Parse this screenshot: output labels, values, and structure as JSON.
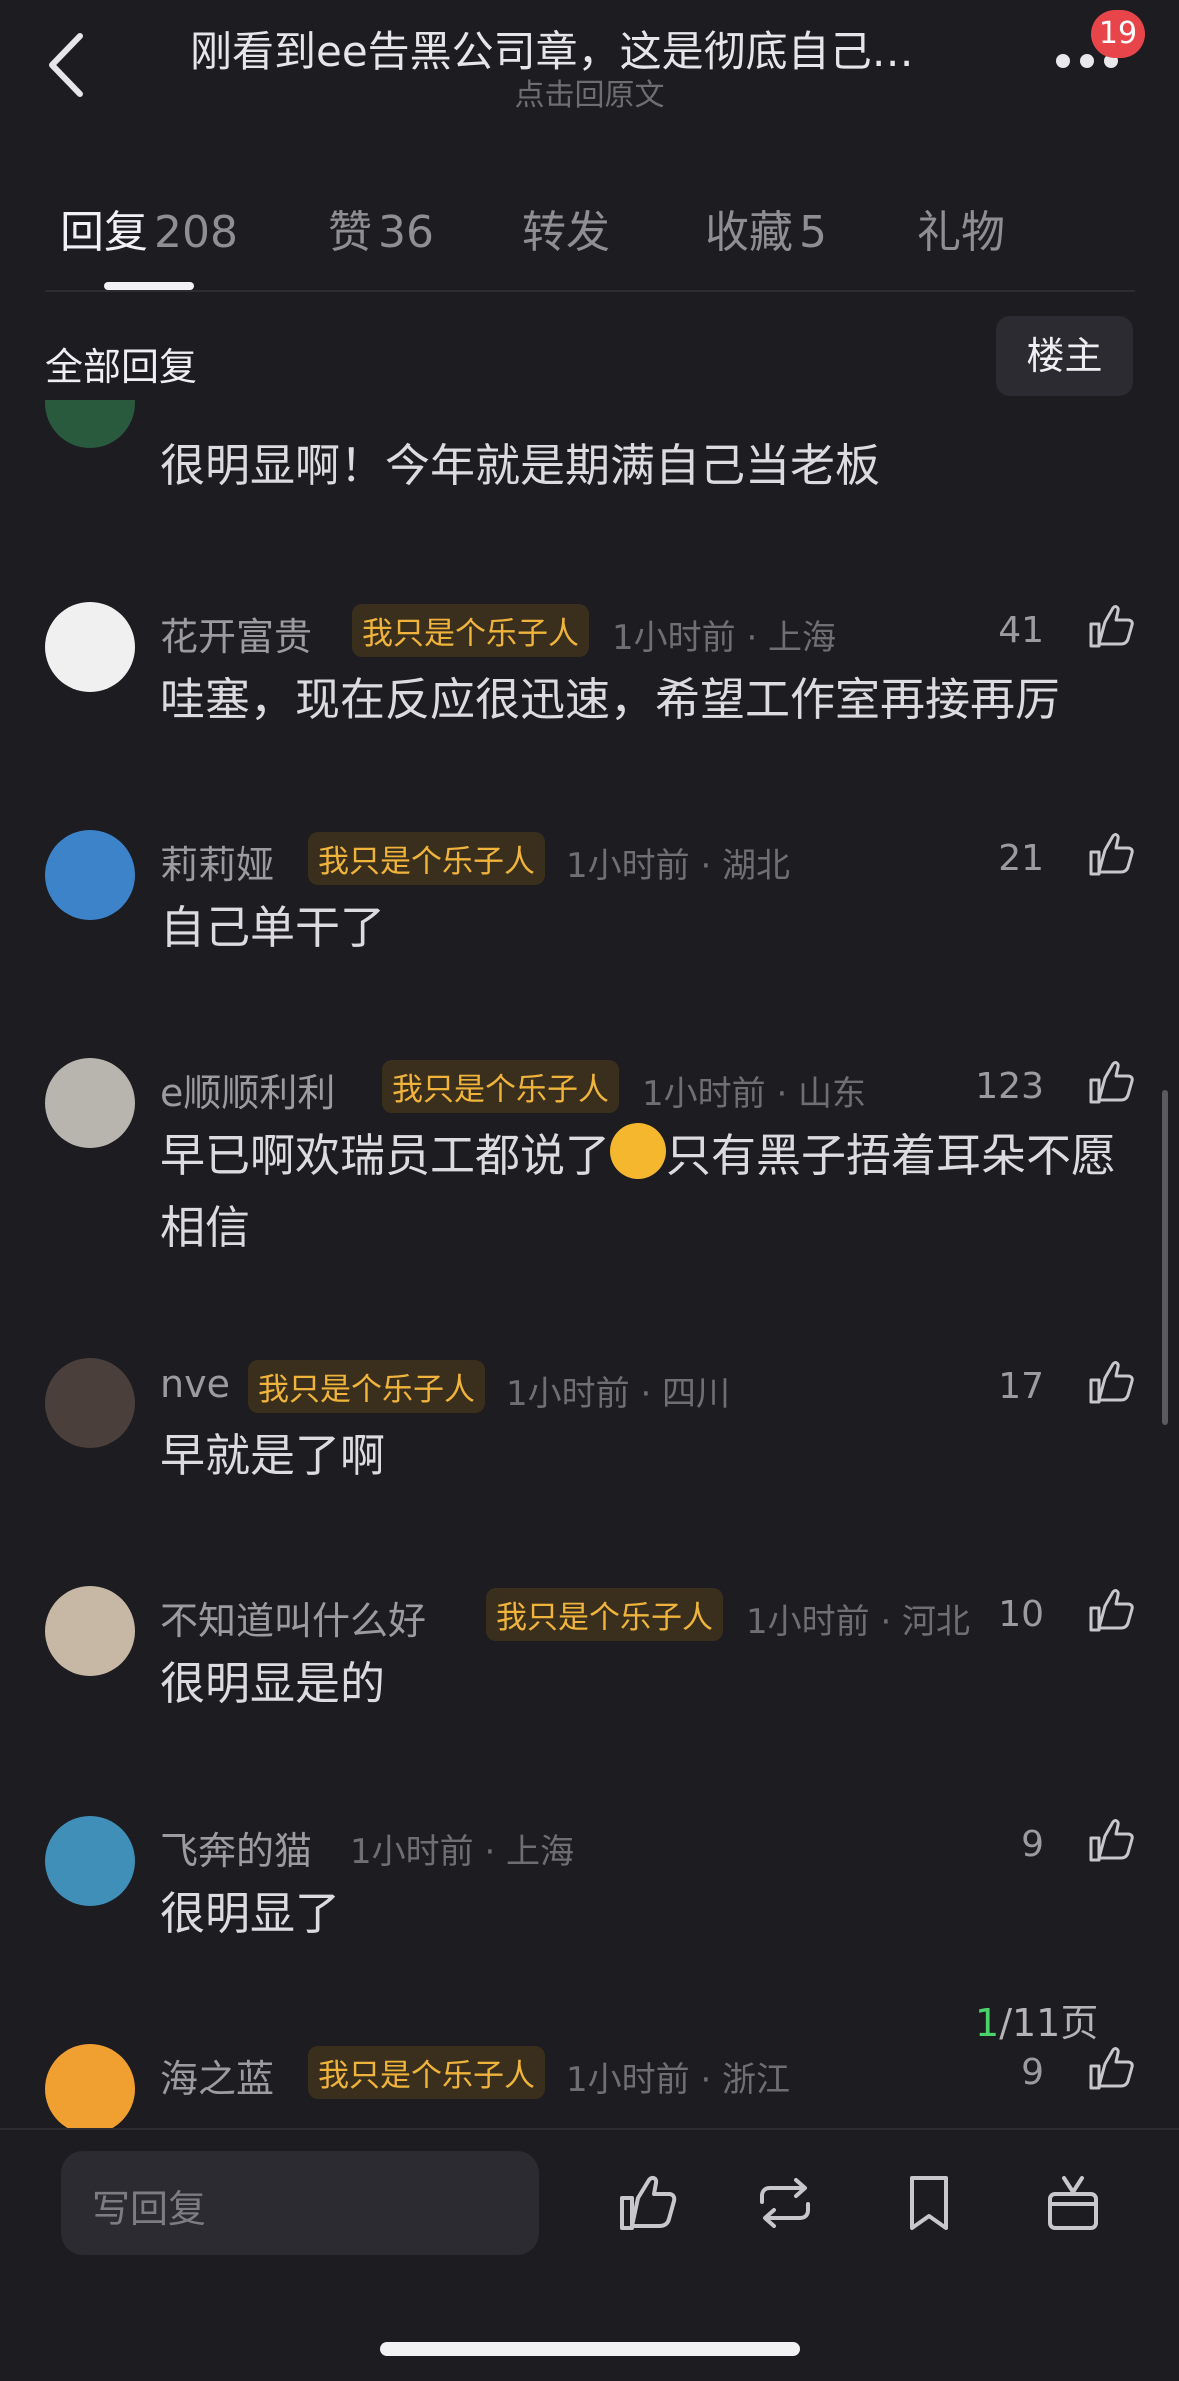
{
  "header": {
    "title": "刚看到ee告黑公司章，这是彻底自己…",
    "subtitle": "点击回原文",
    "notification_count": "19"
  },
  "tabs": [
    {
      "label": "回复",
      "count": "208"
    },
    {
      "label": "赞",
      "count": "36"
    },
    {
      "label": "转发",
      "count": ""
    },
    {
      "label": "收藏",
      "count": "5"
    },
    {
      "label": "礼物",
      "count": ""
    }
  ],
  "filter": {
    "all_label": "全部回复",
    "owner_label": "楼主"
  },
  "comments": [
    {
      "name": "",
      "tag": "",
      "meta": "",
      "likes": "",
      "content": "很明显啊！今年就是期满自己当老板"
    },
    {
      "name": "花开富贵",
      "tag": "我只是个乐子人",
      "meta": "1小时前 · 上海",
      "likes": "41",
      "content": "哇塞，现在反应很迅速，希望工作室再接再厉"
    },
    {
      "name": "莉莉娅",
      "tag": "我只是个乐子人",
      "meta": "1小时前 · 湖北",
      "likes": "21",
      "content": "自己单干了"
    },
    {
      "name": "e顺顺利利",
      "tag": "我只是个乐子人",
      "meta": "1小时前 · 山东",
      "likes": "123",
      "content_a": "早已啊欢瑞员工都说了",
      "content_b": "只有黑子捂着耳朵不愿相信"
    },
    {
      "name": "nve",
      "tag": "我只是个乐子人",
      "meta": "1小时前 · 四川",
      "likes": "17",
      "content": "早就是了啊"
    },
    {
      "name": "不知道叫什么好",
      "tag": "我只是个乐子人",
      "meta": "1小时前 · 河北",
      "likes": "10",
      "content": "很明显是的"
    },
    {
      "name": "飞奔的猫",
      "tag": "",
      "meta": "1小时前 · 上海",
      "likes": "9",
      "content": "很明显了"
    },
    {
      "name": "海之蓝",
      "tag": "我只是个乐子人",
      "meta": "1小时前 · 浙江",
      "likes": "9",
      "content": ""
    }
  ],
  "pagination": {
    "current": "1",
    "total": "/11页"
  },
  "bottom_bar": {
    "reply_placeholder": "写回复"
  },
  "colors": {
    "background": "#1c1c21",
    "tag_text": "#f0b43c",
    "tag_bg": "#3a2f1c",
    "badge": "#e8454b",
    "page_current": "#4bd36b"
  }
}
